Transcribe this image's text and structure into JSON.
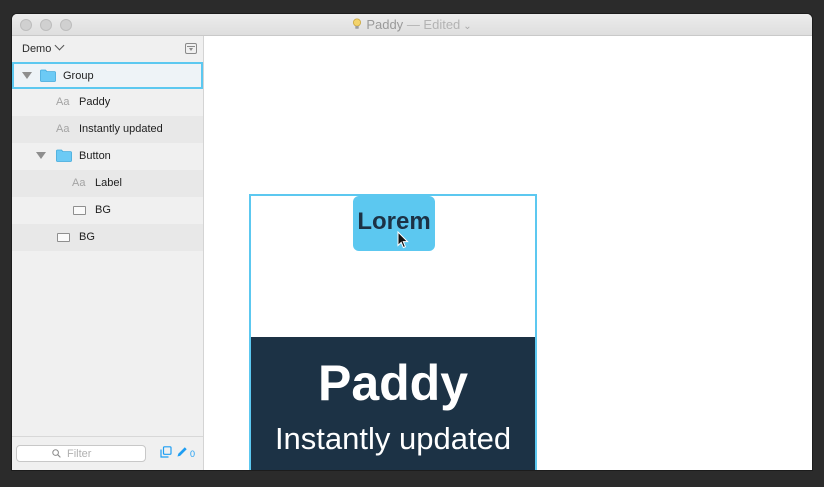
{
  "window": {
    "title": "Paddy",
    "title_status": "— Edited"
  },
  "sidebar": {
    "page_name": "Demo",
    "layers": [
      {
        "label": "Group",
        "kind": "folder-icon"
      },
      {
        "label": "Paddy",
        "kind": "Aa"
      },
      {
        "label": "Instantly updated",
        "kind": "Aa"
      },
      {
        "label": "Button",
        "kind": "folder-icon"
      },
      {
        "label": "Label",
        "kind": "Aa"
      },
      {
        "label": "BG",
        "kind": "rectangle-icon"
      },
      {
        "label": "BG",
        "kind": "rectangle-icon"
      }
    ],
    "filter_placeholder": "Filter",
    "filter_value": "",
    "selection_count": "0"
  },
  "canvas": {
    "button_label": "Lorem",
    "headline": "Paddy",
    "subline": "Instantly updated"
  },
  "colors": {
    "accent": "#5cc8f0",
    "dark_panel": "#1c3245",
    "link_blue": "#1e9ef3"
  }
}
